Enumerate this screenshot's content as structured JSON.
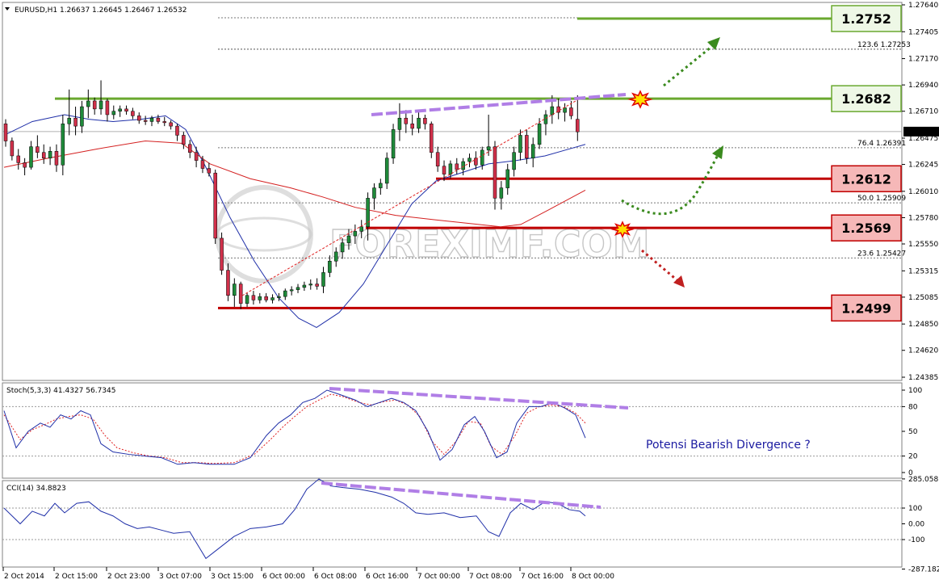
{
  "chart_data": {
    "type": "candlestick",
    "symbol_header": "EURUSD,H1  1.26637 1.26645 1.26467 1.26532",
    "current_price": "1.26532",
    "watermark": "FOREXIMF.COM",
    "price_ticks": [
      "1.27640",
      "1.27405",
      "1.27170",
      "1.26940",
      "1.26710",
      "1.26475",
      "1.26245",
      "1.26010",
      "1.25780",
      "1.25550",
      "1.25315",
      "1.25085",
      "1.24850",
      "1.24620",
      "1.24385"
    ],
    "time_labels": [
      "2 Oct 2014",
      "2 Oct 15:00",
      "2 Oct 23:00",
      "3 Oct 07:00",
      "3 Oct 15:00",
      "6 Oct 00:00",
      "6 Oct 08:00",
      "6 Oct 16:00",
      "7 Oct 00:00",
      "7 Oct 08:00",
      "7 Oct 16:00",
      "8 Oct 00:00"
    ],
    "fib_levels": [
      {
        "text": "123.6 1.27253",
        "price": 1.27253
      },
      {
        "text": "76.4 1.26391",
        "price": 1.26391
      },
      {
        "text": "50.0 1.25909",
        "price": 1.25909
      },
      {
        "text": "23.6 1.25427",
        "price": 1.25427
      }
    ],
    "levels": [
      {
        "label": "1.2752",
        "price": 1.2752,
        "kind": "resistance",
        "color": "#6aa82f"
      },
      {
        "label": "1.2682",
        "price": 1.2682,
        "kind": "resistance",
        "color": "#6aa82f"
      },
      {
        "label": "1.2612",
        "price": 1.2612,
        "kind": "support",
        "color": "#c00000"
      },
      {
        "label": "1.2569",
        "price": 1.2569,
        "kind": "support",
        "color": "#c00000"
      },
      {
        "label": "1.2499",
        "price": 1.2499,
        "kind": "support",
        "color": "#c00000"
      }
    ],
    "ohlc": [
      [
        1.266,
        1.2664,
        1.264,
        1.2645
      ],
      [
        1.2645,
        1.2648,
        1.2628,
        1.2632
      ],
      [
        1.2632,
        1.2638,
        1.262,
        1.2626
      ],
      [
        1.2626,
        1.263,
        1.2615,
        1.2622
      ],
      [
        1.2622,
        1.2645,
        1.262,
        1.264
      ],
      [
        1.264,
        1.265,
        1.263,
        1.2635
      ],
      [
        1.2635,
        1.2642,
        1.2625,
        1.263
      ],
      [
        1.263,
        1.264,
        1.2624,
        1.2636
      ],
      [
        1.2636,
        1.2642,
        1.2618,
        1.2624
      ],
      [
        1.2624,
        1.2668,
        1.2615,
        1.266
      ],
      [
        1.266,
        1.269,
        1.265,
        1.2665
      ],
      [
        1.2665,
        1.2675,
        1.265,
        1.2658
      ],
      [
        1.2658,
        1.268,
        1.2652,
        1.2675
      ],
      [
        1.2675,
        1.269,
        1.2665,
        1.268
      ],
      [
        1.268,
        1.2683,
        1.2668,
        1.2673
      ],
      [
        1.2673,
        1.2698,
        1.2668,
        1.268
      ],
      [
        1.268,
        1.2682,
        1.2662,
        1.2668
      ],
      [
        1.2668,
        1.2676,
        1.2664,
        1.2671
      ],
      [
        1.2671,
        1.2676,
        1.2666,
        1.2673
      ],
      [
        1.2673,
        1.2676,
        1.2668,
        1.2671
      ],
      [
        1.2671,
        1.2674,
        1.2664,
        1.2667
      ],
      [
        1.2667,
        1.267,
        1.266,
        1.2663
      ],
      [
        1.2663,
        1.2667,
        1.2659,
        1.2662
      ],
      [
        1.2662,
        1.2667,
        1.2658,
        1.2665
      ],
      [
        1.2665,
        1.2668,
        1.266,
        1.2662
      ],
      [
        1.2662,
        1.2666,
        1.2658,
        1.2661
      ],
      [
        1.2661,
        1.2663,
        1.2655,
        1.2658
      ],
      [
        1.2658,
        1.266,
        1.2645,
        1.265
      ],
      [
        1.265,
        1.2653,
        1.2638,
        1.2642
      ],
      [
        1.2642,
        1.2646,
        1.263,
        1.2635
      ],
      [
        1.2635,
        1.264,
        1.2622,
        1.2628
      ],
      [
        1.2628,
        1.2632,
        1.2617,
        1.2621
      ],
      [
        1.2621,
        1.2626,
        1.2614,
        1.2617
      ],
      [
        1.2617,
        1.262,
        1.2555,
        1.256
      ],
      [
        1.256,
        1.2565,
        1.2528,
        1.2532
      ],
      [
        1.2532,
        1.2538,
        1.2505,
        1.251
      ],
      [
        1.251,
        1.2525,
        1.25,
        1.252
      ],
      [
        1.252,
        1.2522,
        1.2498,
        1.2503
      ],
      [
        1.2503,
        1.2512,
        1.25,
        1.251
      ],
      [
        1.251,
        1.2514,
        1.2502,
        1.2506
      ],
      [
        1.2506,
        1.2512,
        1.2503,
        1.2509
      ],
      [
        1.2509,
        1.2512,
        1.2504,
        1.2506
      ],
      [
        1.2506,
        1.2511,
        1.2503,
        1.2508
      ],
      [
        1.2508,
        1.2512,
        1.2505,
        1.2509
      ],
      [
        1.2509,
        1.2516,
        1.2506,
        1.2514
      ],
      [
        1.2514,
        1.2518,
        1.251,
        1.2515
      ],
      [
        1.2515,
        1.252,
        1.2512,
        1.2517
      ],
      [
        1.2517,
        1.2522,
        1.2514,
        1.2519
      ],
      [
        1.2519,
        1.2524,
        1.2515,
        1.252
      ],
      [
        1.252,
        1.2525,
        1.2515,
        1.2518
      ],
      [
        1.2518,
        1.2535,
        1.2512,
        1.253
      ],
      [
        1.253,
        1.2545,
        1.2526,
        1.254
      ],
      [
        1.254,
        1.2552,
        1.2535,
        1.2548
      ],
      [
        1.2548,
        1.256,
        1.2542,
        1.2556
      ],
      [
        1.2556,
        1.2568,
        1.255,
        1.2562
      ],
      [
        1.2562,
        1.2572,
        1.2555,
        1.2566
      ],
      [
        1.2566,
        1.2576,
        1.256,
        1.257
      ],
      [
        1.257,
        1.26,
        1.2558,
        1.2595
      ],
      [
        1.2595,
        1.2608,
        1.2585,
        1.2604
      ],
      [
        1.2604,
        1.2612,
        1.2598,
        1.2608
      ],
      [
        1.2608,
        1.2635,
        1.2603,
        1.263
      ],
      [
        1.263,
        1.266,
        1.2625,
        1.2655
      ],
      [
        1.2655,
        1.2678,
        1.2645,
        1.2665
      ],
      [
        1.2665,
        1.2672,
        1.2652,
        1.266
      ],
      [
        1.266,
        1.2668,
        1.265,
        1.2656
      ],
      [
        1.2656,
        1.267,
        1.2652,
        1.2665
      ],
      [
        1.2665,
        1.2668,
        1.2655,
        1.266
      ],
      [
        1.266,
        1.2662,
        1.263,
        1.2635
      ],
      [
        1.2635,
        1.264,
        1.2618,
        1.2623
      ],
      [
        1.2623,
        1.2628,
        1.261,
        1.2616
      ],
      [
        1.2616,
        1.2628,
        1.2612,
        1.2625
      ],
      [
        1.2625,
        1.263,
        1.2616,
        1.262
      ],
      [
        1.262,
        1.263,
        1.2615,
        1.2627
      ],
      [
        1.2627,
        1.2634,
        1.2622,
        1.263
      ],
      [
        1.263,
        1.2636,
        1.262,
        1.2624
      ],
      [
        1.2624,
        1.264,
        1.262,
        1.2637
      ],
      [
        1.2637,
        1.2668,
        1.2632,
        1.264
      ],
      [
        1.264,
        1.2645,
        1.2585,
        1.2595
      ],
      [
        1.2595,
        1.261,
        1.2585,
        1.2604
      ],
      [
        1.2604,
        1.2625,
        1.2598,
        1.262
      ],
      [
        1.262,
        1.264,
        1.2614,
        1.2635
      ],
      [
        1.2635,
        1.2655,
        1.2628,
        1.265
      ],
      [
        1.265,
        1.2655,
        1.2625,
        1.263
      ],
      [
        1.263,
        1.2648,
        1.2622,
        1.2642
      ],
      [
        1.2642,
        1.2665,
        1.2638,
        1.266
      ],
      [
        1.266,
        1.2672,
        1.265,
        1.2668
      ],
      [
        1.2668,
        1.2685,
        1.266,
        1.2675
      ],
      [
        1.2675,
        1.2682,
        1.2664,
        1.267
      ],
      [
        1.267,
        1.2678,
        1.2662,
        1.2674
      ],
      [
        1.2674,
        1.268,
        1.2664,
        1.2667
      ],
      [
        1.2664,
        1.2685,
        1.2645,
        1.2653
      ]
    ],
    "ma_fast": [
      [
        5,
        1.265
      ],
      [
        40,
        1.2662
      ],
      [
        80,
        1.2668
      ],
      [
        110,
        1.2664
      ],
      [
        140,
        1.2662
      ],
      [
        175,
        1.2664
      ],
      [
        205,
        1.2667
      ],
      [
        230,
        1.2655
      ],
      [
        255,
        1.2622
      ],
      [
        285,
        1.2578
      ],
      [
        315,
        1.254
      ],
      [
        345,
        1.2508
      ],
      [
        370,
        1.249
      ],
      [
        392,
        1.2482
      ],
      [
        420,
        1.2495
      ],
      [
        450,
        1.252
      ],
      [
        480,
        1.2555
      ],
      [
        510,
        1.259
      ],
      [
        540,
        1.261
      ],
      [
        575,
        1.2618
      ],
      [
        605,
        1.2625
      ],
      [
        640,
        1.2628
      ],
      [
        675,
        1.2632
      ],
      [
        705,
        1.2638
      ],
      [
        725,
        1.2642
      ]
    ],
    "ma_slow": [
      [
        5,
        1.2622
      ],
      [
        60,
        1.263
      ],
      [
        120,
        1.2638
      ],
      [
        180,
        1.2645
      ],
      [
        225,
        1.2643
      ],
      [
        260,
        1.2625
      ],
      [
        310,
        1.2612
      ],
      [
        360,
        1.2604
      ],
      [
        400,
        1.2596
      ],
      [
        440,
        1.2587
      ],
      [
        490,
        1.258
      ],
      [
        540,
        1.2576
      ],
      [
        580,
        1.2573
      ],
      [
        620,
        1.257
      ],
      [
        645,
        1.2572
      ],
      [
        680,
        1.2585
      ],
      [
        725,
        1.2602
      ]
    ],
    "stoch": {
      "header": "Stoch(5,3,3) 41.4327 56.7345",
      "ticks": [
        "100",
        "80",
        "50",
        "20",
        "0"
      ],
      "k": [
        [
          5,
          75
        ],
        [
          20,
          30
        ],
        [
          35,
          50
        ],
        [
          50,
          60
        ],
        [
          62,
          55
        ],
        [
          75,
          70
        ],
        [
          88,
          65
        ],
        [
          100,
          75
        ],
        [
          112,
          70
        ],
        [
          125,
          35
        ],
        [
          140,
          25
        ],
        [
          160,
          22
        ],
        [
          180,
          20
        ],
        [
          200,
          18
        ],
        [
          220,
          10
        ],
        [
          240,
          12
        ],
        [
          260,
          10
        ],
        [
          290,
          10
        ],
        [
          310,
          18
        ],
        [
          330,
          45
        ],
        [
          345,
          60
        ],
        [
          360,
          70
        ],
        [
          375,
          85
        ],
        [
          390,
          90
        ],
        [
          405,
          100
        ],
        [
          420,
          95
        ],
        [
          440,
          88
        ],
        [
          455,
          80
        ],
        [
          470,
          85
        ],
        [
          485,
          90
        ],
        [
          500,
          85
        ],
        [
          515,
          75
        ],
        [
          530,
          50
        ],
        [
          545,
          15
        ],
        [
          560,
          28
        ],
        [
          575,
          58
        ],
        [
          588,
          68
        ],
        [
          600,
          50
        ],
        [
          615,
          18
        ],
        [
          628,
          25
        ],
        [
          640,
          60
        ],
        [
          655,
          80
        ],
        [
          670,
          80
        ],
        [
          685,
          85
        ],
        [
          700,
          78
        ],
        [
          713,
          70
        ],
        [
          725,
          42
        ]
      ],
      "d": [
        [
          5,
          70
        ],
        [
          25,
          40
        ],
        [
          40,
          52
        ],
        [
          55,
          58
        ],
        [
          70,
          65
        ],
        [
          85,
          68
        ],
        [
          100,
          70
        ],
        [
          115,
          65
        ],
        [
          130,
          45
        ],
        [
          145,
          30
        ],
        [
          165,
          24
        ],
        [
          185,
          20
        ],
        [
          205,
          18
        ],
        [
          225,
          12
        ],
        [
          245,
          12
        ],
        [
          265,
          11
        ],
        [
          290,
          12
        ],
        [
          315,
          22
        ],
        [
          335,
          40
        ],
        [
          350,
          55
        ],
        [
          365,
          68
        ],
        [
          380,
          80
        ],
        [
          395,
          88
        ],
        [
          410,
          95
        ],
        [
          425,
          92
        ],
        [
          445,
          85
        ],
        [
          460,
          82
        ],
        [
          475,
          86
        ],
        [
          490,
          88
        ],
        [
          505,
          82
        ],
        [
          520,
          68
        ],
        [
          535,
          38
        ],
        [
          550,
          22
        ],
        [
          565,
          38
        ],
        [
          580,
          62
        ],
        [
          595,
          60
        ],
        [
          608,
          32
        ],
        [
          622,
          22
        ],
        [
          638,
          45
        ],
        [
          652,
          72
        ],
        [
          668,
          80
        ],
        [
          683,
          82
        ],
        [
          698,
          80
        ],
        [
          713,
          72
        ],
        [
          725,
          60
        ]
      ]
    },
    "stoch_note": "Potensi Bearish Divergence ?",
    "cci": {
      "header": "CCI(14) 34.8823",
      "ticks": [
        "285.058",
        "100",
        "0.00",
        "-100",
        "-287.1825"
      ],
      "values": [
        [
          5,
          100
        ],
        [
          15,
          50
        ],
        [
          25,
          0
        ],
        [
          40,
          80
        ],
        [
          55,
          50
        ],
        [
          68,
          130
        ],
        [
          80,
          70
        ],
        [
          95,
          130
        ],
        [
          110,
          140
        ],
        [
          125,
          80
        ],
        [
          140,
          50
        ],
        [
          155,
          0
        ],
        [
          170,
          -30
        ],
        [
          185,
          -20
        ],
        [
          200,
          -40
        ],
        [
          215,
          -60
        ],
        [
          235,
          -50
        ],
        [
          255,
          -220
        ],
        [
          270,
          -160
        ],
        [
          290,
          -80
        ],
        [
          310,
          -30
        ],
        [
          330,
          -20
        ],
        [
          350,
          0
        ],
        [
          365,
          90
        ],
        [
          380,
          220
        ],
        [
          395,
          285
        ],
        [
          410,
          240
        ],
        [
          425,
          230
        ],
        [
          445,
          220
        ],
        [
          465,
          200
        ],
        [
          485,
          170
        ],
        [
          500,
          130
        ],
        [
          515,
          70
        ],
        [
          530,
          60
        ],
        [
          550,
          70
        ],
        [
          570,
          40
        ],
        [
          590,
          50
        ],
        [
          605,
          -50
        ],
        [
          618,
          -80
        ],
        [
          632,
          70
        ],
        [
          645,
          130
        ],
        [
          660,
          90
        ],
        [
          675,
          140
        ],
        [
          690,
          130
        ],
        [
          705,
          90
        ],
        [
          718,
          80
        ],
        [
          725,
          50
        ]
      ]
    }
  }
}
